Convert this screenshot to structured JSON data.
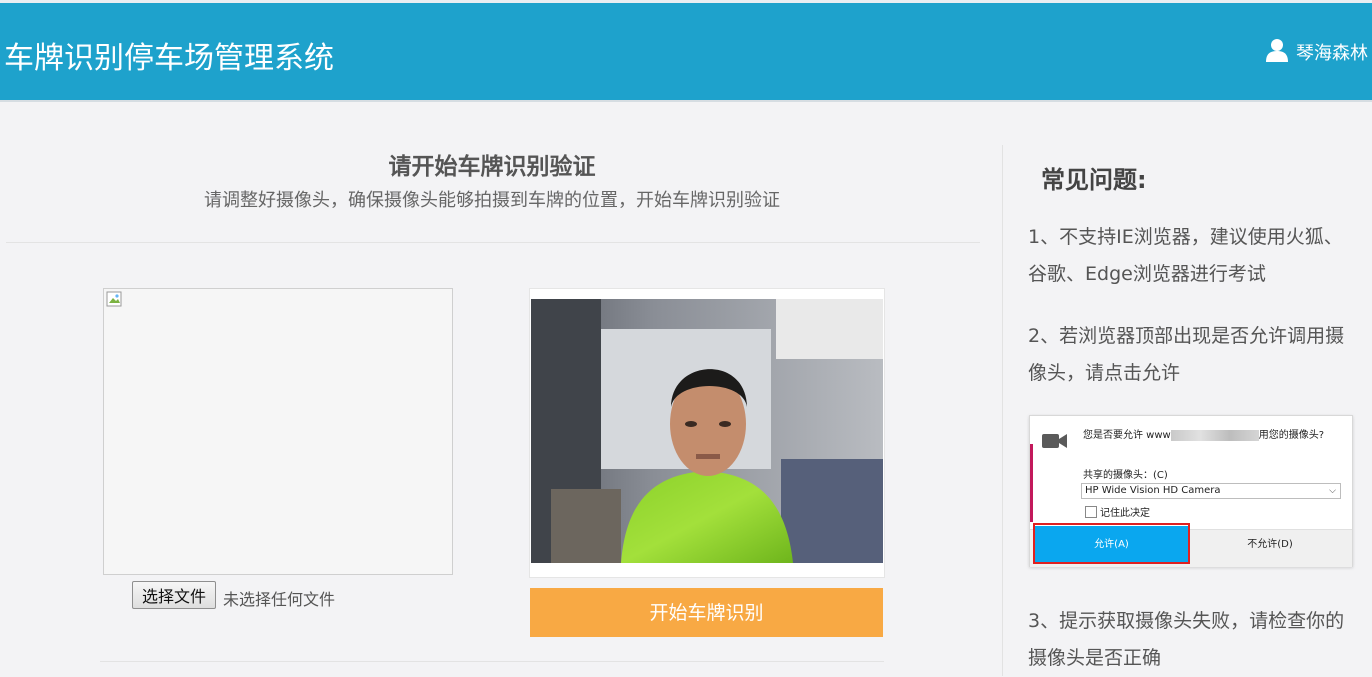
{
  "header": {
    "app_title": "车牌识别停车场管理系统",
    "user_name": "琴海森林",
    "user_icon": "user-icon",
    "background_color": "#1ea2cc"
  },
  "main": {
    "heading": "请开始车牌识别验证",
    "subheading": "请调整好摄像头，确保摄像头能够拍摄到车牌的位置，开始车牌识别验证",
    "file_button_label": "选择文件",
    "file_status": "未选择任何文件",
    "start_button_label": "开始车牌识别",
    "start_button_color": "#f8a944"
  },
  "faq": {
    "title": "常见问题:",
    "items": [
      "1、不支持IE浏览器，建议使用火狐、谷歌、Edge浏览器进行考试",
      "2、若浏览器顶部出现是否允许调用摄像头，请点击允许",
      "3、提示获取摄像头失败，请检查你的摄像头是否正确"
    ],
    "dialog": {
      "question_prefix": "您是否要允许 www",
      "question_suffix": "用您的摄像头?",
      "share_label": "共享的摄像头：(C)",
      "camera_option": "HP Wide Vision HD Camera",
      "remember_label": "记住此决定",
      "allow_label": "允许(A)",
      "deny_label": "不允许(D)"
    }
  }
}
